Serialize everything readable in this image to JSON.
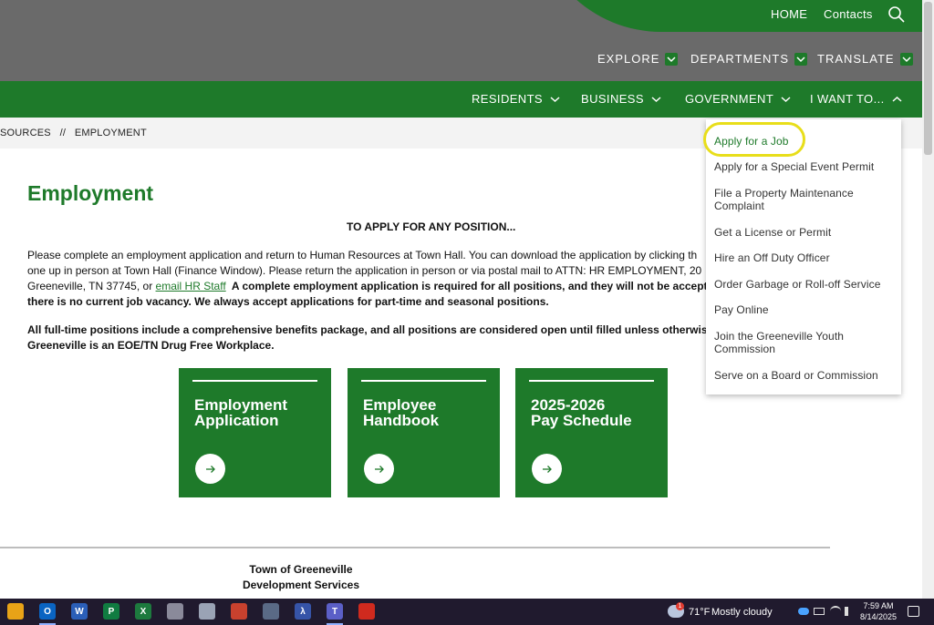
{
  "header": {
    "util_links": [
      "HOME",
      "Contacts"
    ],
    "secondary_nav": [
      "EXPLORE",
      "DEPARTMENTS",
      "TRANSLATE"
    ],
    "main_nav": [
      "RESIDENTS",
      "BUSINESS",
      "GOVERNMENT",
      "I WANT TO..."
    ]
  },
  "breadcrumb": {
    "text": "SOURCES   //   EMPLOYMENT"
  },
  "content": {
    "title": "Employment",
    "center_heading": "TO APPLY FOR ANY POSITION...",
    "para1": [
      "Please complete an employment application and return to Human Resources at Town Hall.  You can download the application by clicking th",
      "one up in person at Town Hall (Finance Window). Please return the application in person or via postal mail to ATTN: HR EMPLOYMENT, 20",
      "Greeneville, TN 37745, or ",
      "there is no current job vacancy.  We always accept applications for part-time and seasonal positions."
    ],
    "para1_link": "email HR Staff",
    "para1_bold_tail": "  A complete employment application is required for all positions, and they will not be accepted",
    "para2": [
      "All full-time positions include a comprehensive benefits package, and all positions are considered open until filled unless otherwise no",
      "Greeneville is an EOE/TN Drug Free Workplace."
    ],
    "cards": [
      {
        "line1": "Employment",
        "line2": "Application"
      },
      {
        "line1": "Employee",
        "line2": "Handbook"
      },
      {
        "line1": "2025-2026",
        "line2": "Pay Schedule"
      }
    ]
  },
  "footer": {
    "line1": "Town of Greeneville",
    "line2": "Development Services"
  },
  "dropdown": {
    "items": [
      "Apply for a Job",
      "Apply for a Special Event Permit",
      "File a Property Maintenance Complaint",
      "Get a License or Permit",
      "Hire an Off Duty Officer",
      "Order Garbage or Roll-off Service",
      "Pay Online",
      "Join the Greeneville Youth Commission",
      "Serve on a Board or Commission"
    ]
  },
  "taskbar": {
    "weather_temp": "71°F",
    "weather_desc": "Mostly cloudy",
    "time": "7:59 AM",
    "date": "8/14/2025",
    "notification_badge": "1"
  },
  "colors": {
    "brand_green": "#1e7a2a",
    "header_gray": "#6a6a6a",
    "highlight_yellow": "#e8de1a"
  }
}
